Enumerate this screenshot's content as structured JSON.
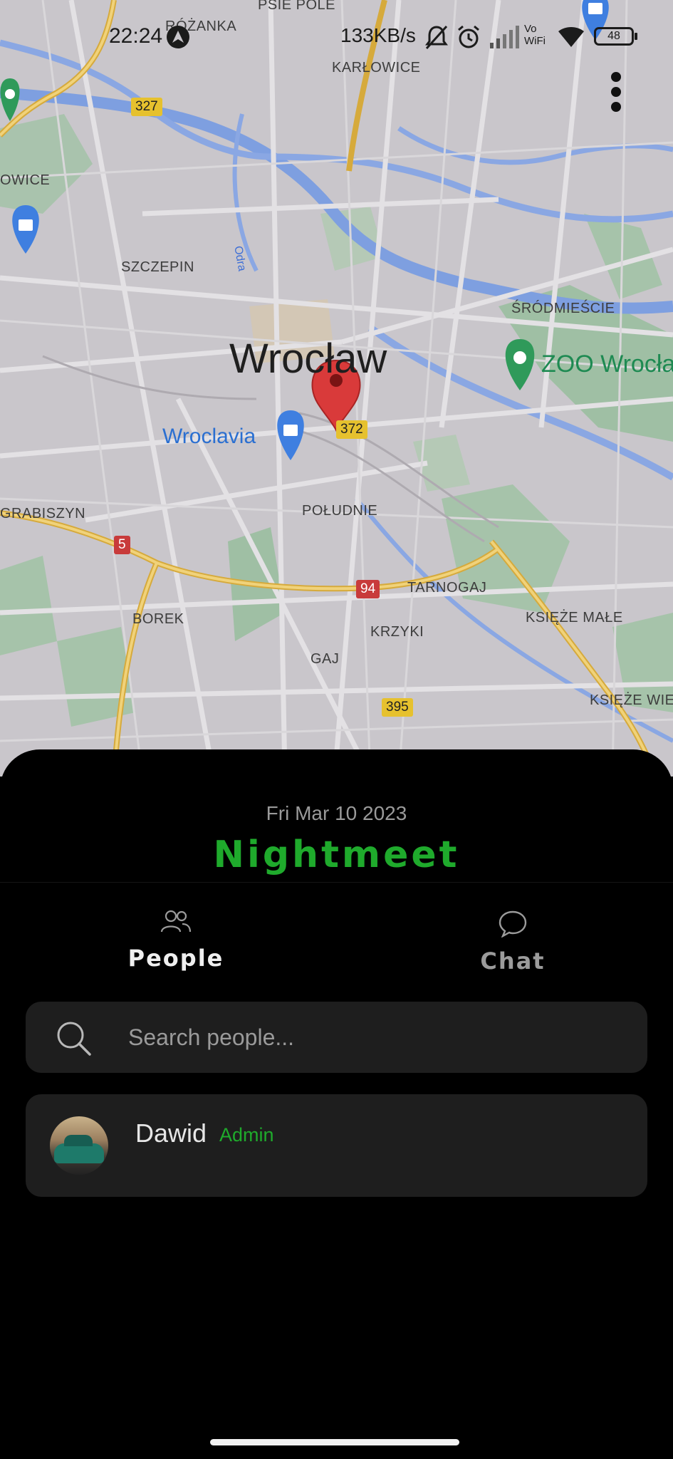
{
  "status_bar": {
    "time": "22:24",
    "network_speed": "133KB/s",
    "wifi_label_top": "Vo",
    "wifi_label_bottom": "WiFi",
    "battery": "48"
  },
  "map": {
    "labels": {
      "rozanka": "RÓŻANKA",
      "psie_pole": "PSIE POLE",
      "karlowice": "KARŁOWICE",
      "owice": "OWICE",
      "szczepin": "SZCZEPIN",
      "odra": "Odra",
      "srodmiescie": "ŚRÓDMIEŚCIE",
      "city": "Wrocław",
      "zoo": "ZOO Wrocław",
      "wroclavia": "Wroclavia",
      "grabiszyn": "GRABISZYN",
      "poludnie": "POŁUDNIE",
      "tarnogaj": "TARNOGAJ",
      "borek": "BOREK",
      "krzyki": "KRZYKI",
      "ksieze_male": "KSIĘŻE MAŁE",
      "gaj": "GAJ",
      "ksieze_wielkie": "KSIĘŻE WIEL"
    },
    "road_shields": {
      "r327": "327",
      "r372": "372",
      "r5": "5",
      "r94": "94",
      "r395": "395"
    }
  },
  "sheet": {
    "date": "Fri Mar 10 2023",
    "title": "Nightmeet",
    "tabs": [
      {
        "label": "People"
      },
      {
        "label": "Chat"
      }
    ],
    "search": {
      "placeholder": "Search people..."
    },
    "people": [
      {
        "name": "Dawid",
        "role": "Admin"
      }
    ]
  },
  "colors": {
    "accent_green": "#1faa2c",
    "sheet_bg": "#000000",
    "card_bg": "#1e1e1e",
    "pin_red": "#d93a3a"
  }
}
